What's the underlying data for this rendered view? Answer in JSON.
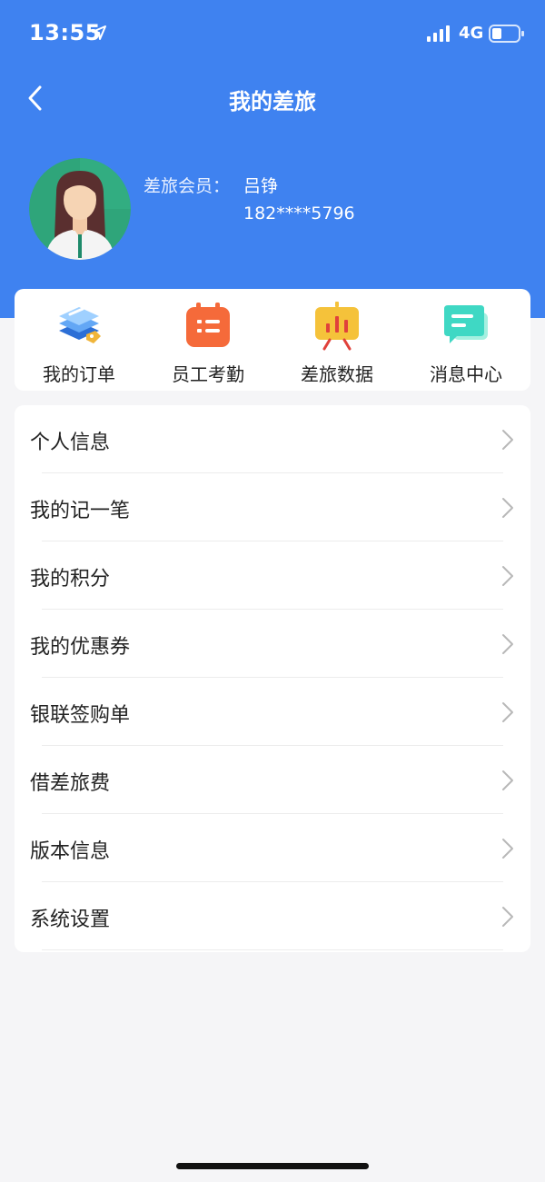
{
  "status_bar": {
    "time": "13:55",
    "network": "4G"
  },
  "nav": {
    "title": "我的差旅"
  },
  "profile": {
    "member_label": "差旅会员：",
    "name": "吕铮",
    "phone": "182****5796"
  },
  "quick_actions": [
    {
      "label": "我的订单",
      "icon": "orders-icon"
    },
    {
      "label": "员工考勤",
      "icon": "attendance-icon"
    },
    {
      "label": "差旅数据",
      "icon": "data-chart-icon"
    },
    {
      "label": "消息中心",
      "icon": "message-icon"
    }
  ],
  "menu": [
    {
      "label": "个人信息"
    },
    {
      "label": "我的记一笔"
    },
    {
      "label": "我的积分"
    },
    {
      "label": "我的优惠券"
    },
    {
      "label": "银联签购单"
    },
    {
      "label": "借差旅费"
    },
    {
      "label": "版本信息"
    },
    {
      "label": "系统设置"
    }
  ],
  "colors": {
    "header_blue": "#3f82f0",
    "background": "#f5f5f7"
  }
}
